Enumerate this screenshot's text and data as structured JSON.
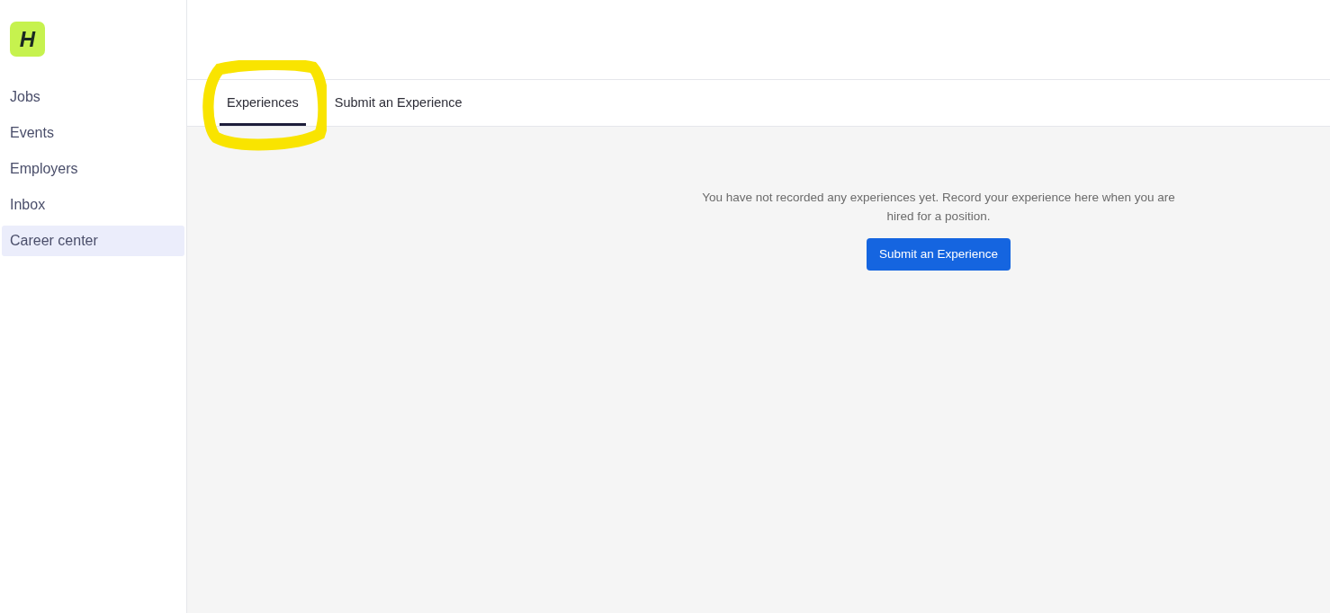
{
  "logo": {
    "text": "H"
  },
  "sidebar": {
    "items": [
      {
        "label": "Jobs",
        "selected": false
      },
      {
        "label": "Events",
        "selected": false
      },
      {
        "label": "Employers",
        "selected": false
      },
      {
        "label": "Inbox",
        "selected": false
      },
      {
        "label": "Career center",
        "selected": true
      }
    ]
  },
  "tabs": [
    {
      "label": "Experiences",
      "selected": true
    },
    {
      "label": "Submit an Experience",
      "selected": false
    }
  ],
  "empty_state": {
    "message": "You have not recorded any experiences yet. Record your experience here when you are hired for a position.",
    "button": "Submit an Experience"
  }
}
